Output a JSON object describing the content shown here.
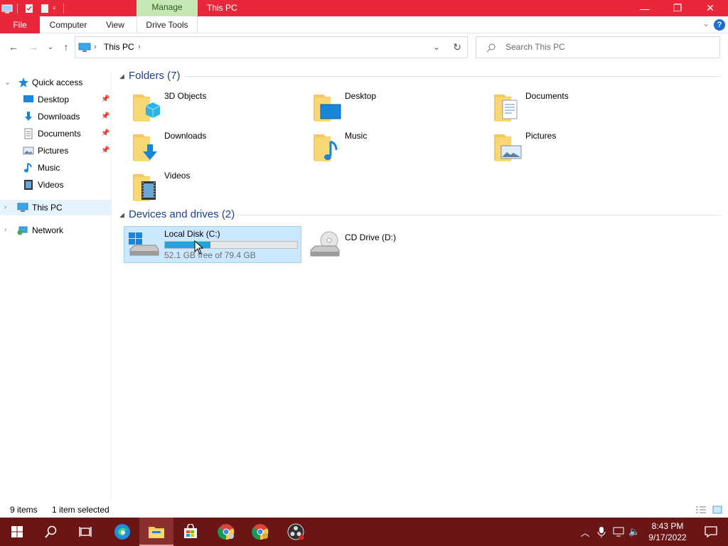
{
  "window": {
    "title": "This PC",
    "context_tab": "Manage",
    "controls": {
      "minimize": "—",
      "maximize": "❐",
      "close": "✕"
    }
  },
  "ribbon": {
    "tabs": [
      {
        "label": "File"
      },
      {
        "label": "Computer"
      },
      {
        "label": "View"
      },
      {
        "label": "Drive Tools"
      }
    ],
    "help": "?"
  },
  "address_bar": {
    "crumb": "This PC"
  },
  "search": {
    "placeholder": "Search This PC"
  },
  "nav_pane": {
    "quick_access": "Quick access",
    "quick_items": [
      {
        "label": "Desktop",
        "icon": "desktop-icon",
        "pinned": true
      },
      {
        "label": "Downloads",
        "icon": "downloads-icon",
        "pinned": true
      },
      {
        "label": "Documents",
        "icon": "documents-icon",
        "pinned": true
      },
      {
        "label": "Pictures",
        "icon": "pictures-icon",
        "pinned": true
      },
      {
        "label": "Music",
        "icon": "music-icon",
        "pinned": false
      },
      {
        "label": "Videos",
        "icon": "videos-icon",
        "pinned": false
      }
    ],
    "this_pc": "This PC",
    "network": "Network"
  },
  "content": {
    "folders_header": "Folders (7)",
    "folders": [
      {
        "name": "3D Objects",
        "icon": "3d-objects-folder-icon"
      },
      {
        "name": "Desktop",
        "icon": "desktop-folder-icon"
      },
      {
        "name": "Documents",
        "icon": "documents-folder-icon"
      },
      {
        "name": "Downloads",
        "icon": "downloads-folder-icon"
      },
      {
        "name": "Music",
        "icon": "music-folder-icon"
      },
      {
        "name": "Pictures",
        "icon": "pictures-folder-icon"
      },
      {
        "name": "Videos",
        "icon": "videos-folder-icon"
      }
    ],
    "drives_header": "Devices and drives (2)",
    "drives": [
      {
        "name": "Local Disk (C:)",
        "free_text": "52.1 GB free of 79.4 GB",
        "used_fraction": 0.344,
        "selected": true
      },
      {
        "name": "CD Drive (D:)",
        "selected": false
      }
    ]
  },
  "status": {
    "items": "9 items",
    "selection": "1 item selected"
  },
  "taskbar": {
    "clock_time": "8:43 PM",
    "clock_date": "9/17/2022"
  },
  "colors": {
    "accent": "#e8283a",
    "manage_tab": "#c7e8b5",
    "taskbar": "#6b1616",
    "selection": "#cce8ff",
    "drive_bar": "#26a0da",
    "group_header": "#1e3f8a"
  }
}
